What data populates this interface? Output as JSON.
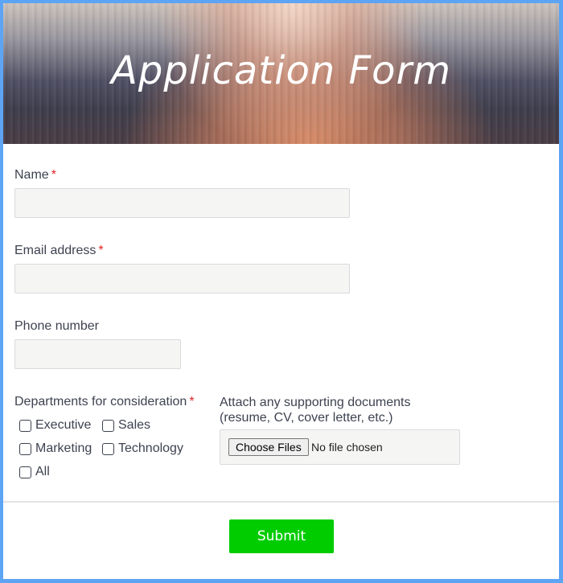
{
  "header": {
    "title": "Application Form"
  },
  "form": {
    "required_marker": "*",
    "name": {
      "label": "Name",
      "required": true,
      "value": "",
      "placeholder": ""
    },
    "email": {
      "label": "Email address",
      "required": true,
      "value": "",
      "placeholder": ""
    },
    "phone": {
      "label": "Phone number",
      "required": false,
      "value": "",
      "placeholder": ""
    },
    "departments": {
      "label": "Departments for consideration",
      "required": true,
      "options": [
        {
          "label": "Executive",
          "checked": false
        },
        {
          "label": "Sales",
          "checked": false
        },
        {
          "label": "Marketing",
          "checked": false
        },
        {
          "label": "Technology",
          "checked": false
        },
        {
          "label": "All",
          "checked": false
        }
      ]
    },
    "attachments": {
      "label_line1": "Attach any supporting documents",
      "label_line2": "(resume, CV, cover letter, etc.)",
      "button_label": "Choose Files",
      "status": "No file chosen"
    },
    "submit_label": "Submit"
  },
  "colors": {
    "frame_border": "#5ea4f4",
    "submit_bg": "#00cc00",
    "required": "#e02424",
    "input_bg": "#f5f5f4"
  }
}
